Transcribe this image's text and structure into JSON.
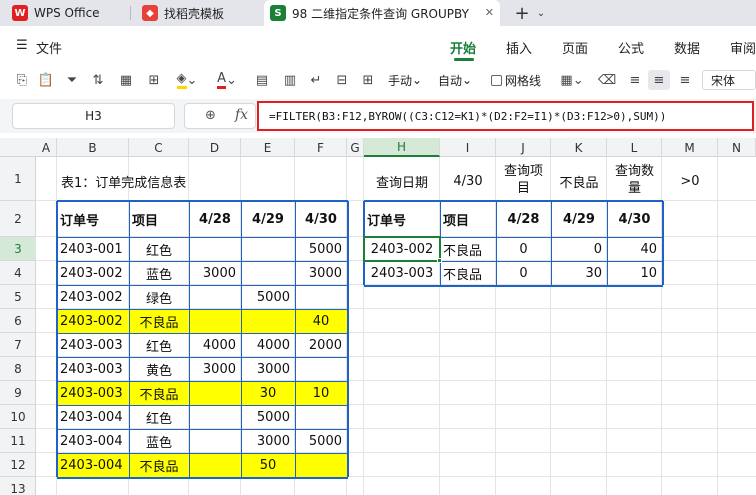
{
  "tabs": [
    {
      "label": "WPS Office",
      "icon": "wps-logo-icon",
      "color": "#e02020"
    },
    {
      "label": "找稻壳模板",
      "icon": "docer-icon",
      "color": "#e8413a"
    },
    {
      "label": "98 二维指定条件查询 GROUPBY",
      "icon": "spreadsheet-icon",
      "color": "#1a7f37",
      "icon_text": "S"
    }
  ],
  "menu": {
    "file_label": "文件",
    "items": [
      "开始",
      "插入",
      "页面",
      "公式",
      "数据",
      "审阅"
    ],
    "active": "开始"
  },
  "toolbar": {
    "manual_label": "手动",
    "auto_label": "自动",
    "gridlines_label": "网格线",
    "font_name": "宋体"
  },
  "formula_bar": {
    "cell_ref": "H3",
    "fx": "fx",
    "formula": "=FILTER(B3:F12,BYROW((C3:C12=K1)*(D2:F2=I1)*(D3:F12>0),SUM))"
  },
  "columns": [
    "A",
    "B",
    "C",
    "D",
    "E",
    "F",
    "G",
    "H",
    "I",
    "J",
    "K",
    "L",
    "M",
    "N"
  ],
  "rows": [
    "1",
    "2",
    "3",
    "4",
    "5",
    "6",
    "7",
    "8",
    "9",
    "10",
    "11",
    "12",
    "13"
  ],
  "selected_column": "H",
  "selected_row": "3",
  "table1": {
    "title": "表1：订单完成信息表",
    "headers": [
      "订单号",
      "项目",
      "4/28",
      "4/29",
      "4/30"
    ],
    "rows": [
      [
        "2403-001",
        "红色",
        "",
        "",
        "5000"
      ],
      [
        "2403-002",
        "蓝色",
        "3000",
        "",
        "3000"
      ],
      [
        "2403-002",
        "绿色",
        "",
        "5000",
        ""
      ],
      [
        "2403-002",
        "不良品",
        "",
        "",
        "40"
      ],
      [
        "2403-003",
        "红色",
        "4000",
        "4000",
        "2000"
      ],
      [
        "2403-003",
        "黄色",
        "3000",
        "3000",
        ""
      ],
      [
        "2403-003",
        "不良品",
        "",
        "30",
        "10"
      ],
      [
        "2403-004",
        "红色",
        "",
        "5000",
        ""
      ],
      [
        "2403-004",
        "蓝色",
        "",
        "3000",
        "5000"
      ],
      [
        "2403-004",
        "不良品",
        "",
        "50",
        ""
      ]
    ],
    "highlight_color": "#ffff00"
  },
  "query": {
    "date_label": "查询日期",
    "date_value": "4/30",
    "item_label_l1": "查询项",
    "item_label_l2": "目",
    "item_value": "不良品",
    "qty_label_l1": "查询数",
    "qty_label_l2": "量",
    "qty_value": ">0"
  },
  "result": {
    "headers": [
      "订单号",
      "项目",
      "4/28",
      "4/29",
      "4/30"
    ],
    "rows": [
      [
        "2403-002",
        "不良品",
        "0",
        "0",
        "40"
      ],
      [
        "2403-003",
        "不良品",
        "0",
        "30",
        "10"
      ]
    ]
  },
  "colors": {
    "accent": "#1a7f37",
    "table_border": "#1e64c8",
    "formula_highlight": "#e02020"
  }
}
